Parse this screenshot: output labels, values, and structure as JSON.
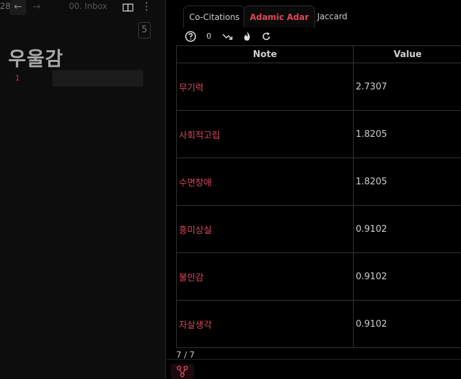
{
  "left_pane": {
    "tab_number": "28",
    "back_glyph": "←",
    "forward_glyph": "→",
    "title": "00. Inbox",
    "more_glyph": "⋮",
    "count_badge": "5",
    "note_heading": "우울감",
    "line_number": "1"
  },
  "right_pane": {
    "tabs": [
      {
        "label": "Co-Citations"
      },
      {
        "label": "Adamic Adar"
      },
      {
        "label": "Jaccard"
      }
    ],
    "active_tab": "Adamic Adar",
    "toolbar": {
      "count": "0",
      "icons": [
        "help-icon",
        "trend-down-icon",
        "flame-icon",
        "refresh-icon"
      ]
    },
    "table": {
      "headers": {
        "note": "Note",
        "value": "Value"
      },
      "rows": [
        {
          "note": "무기력",
          "value": "2.7307"
        },
        {
          "note": "사회적고립",
          "value": "1.8205"
        },
        {
          "note": "수면장애",
          "value": "1.8205"
        },
        {
          "note": "흥미상실",
          "value": "0.9102"
        },
        {
          "note": "불안감",
          "value": "0.9102"
        },
        {
          "note": "자살생각",
          "value": "0.9102"
        }
      ]
    },
    "footer_count": "7 / 7"
  },
  "colors": {
    "accent": "#e0465e",
    "note_link": "#d8475c",
    "background": "#000000",
    "pane_left": "#0d0d0d"
  }
}
